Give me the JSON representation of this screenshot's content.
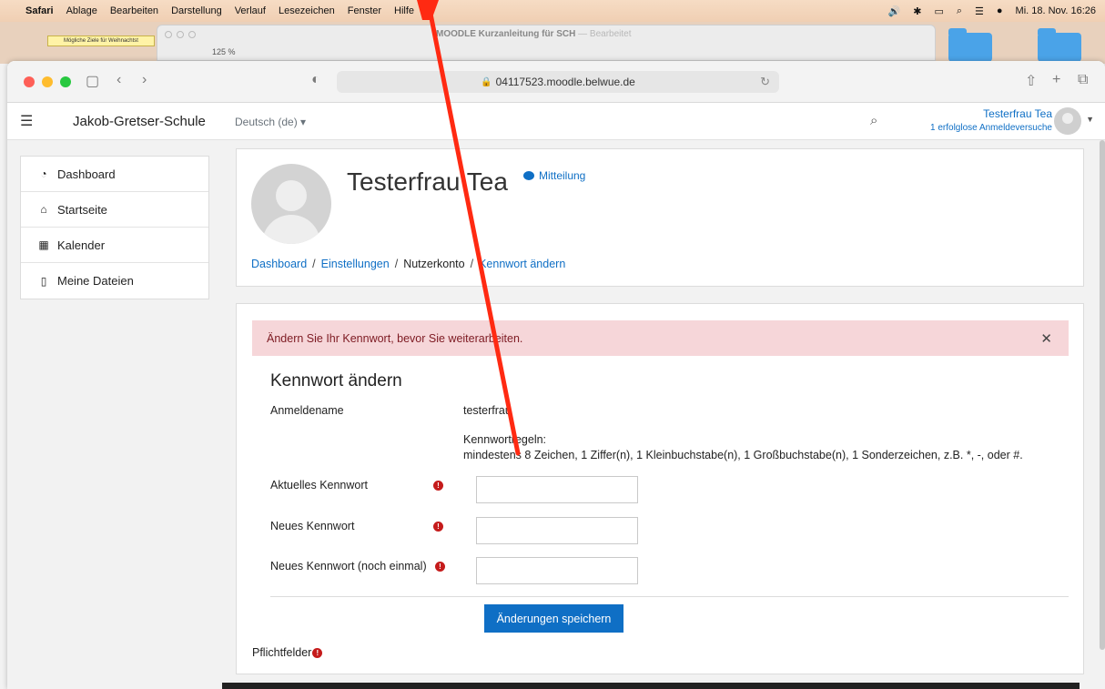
{
  "menubar": {
    "app": "Safari",
    "items": [
      "Ablage",
      "Bearbeiten",
      "Darstellung",
      "Verlauf",
      "Lesezeichen",
      "Fenster",
      "Hilfe"
    ],
    "clock": "Mi. 18. Nov. 16:26"
  },
  "background": {
    "note": "Mögliche Ziele für Weihnachtst",
    "window_title": "MOODLE Kurzanleitung für SCH",
    "window_sub": "— Bearbeitet",
    "zoom": "125 %"
  },
  "browser": {
    "url": "04117523.moodle.belwue.de"
  },
  "navbar": {
    "site_name": "Jakob-Gretser-Schule",
    "language": "Deutsch (de) ▾",
    "user_name": "Testerfrau Tea",
    "failed_logins": "1 erfolglose Anmeldeversuche"
  },
  "sidebar": {
    "items": [
      {
        "label": "Dashboard",
        "icon": "tachometer-icon"
      },
      {
        "label": "Startseite",
        "icon": "home-icon"
      },
      {
        "label": "Kalender",
        "icon": "calendar-icon"
      },
      {
        "label": "Meine Dateien",
        "icon": "file-icon"
      }
    ]
  },
  "header": {
    "name": "Testerfrau Tea",
    "message_link": "Mitteilung",
    "breadcrumb": [
      "Dashboard",
      "Einstellungen",
      "Nutzerkonto",
      "Kennwort ändern"
    ]
  },
  "form": {
    "alert": "Ändern Sie Ihr Kennwort, bevor Sie weiterarbeiten.",
    "title": "Kennwort ändern",
    "username_label": "Anmeldename",
    "username_value": "testerfrau",
    "rules_heading": "Kennwortregeln:",
    "rules_text": "mindestens 8 Zeichen, 1 Ziffer(n), 1 Kleinbuchstabe(n), 1 Großbuchstabe(n), 1 Sonderzeichen, z.B. *, -, oder #.",
    "fields": [
      {
        "label": "Aktuelles Kennwort",
        "value": ""
      },
      {
        "label": "Neues Kennwort",
        "value": ""
      },
      {
        "label": "Neues Kennwort (noch einmal)",
        "value": ""
      }
    ],
    "save_label": "Änderungen speichern",
    "required_note": "Pflichtfelder",
    "required_marker": "!"
  },
  "colors": {
    "link": "#0f6fc5",
    "alert_bg": "#f6d6d9",
    "required": "#c51b1b",
    "annotation_arrow": "#ff2a12"
  }
}
